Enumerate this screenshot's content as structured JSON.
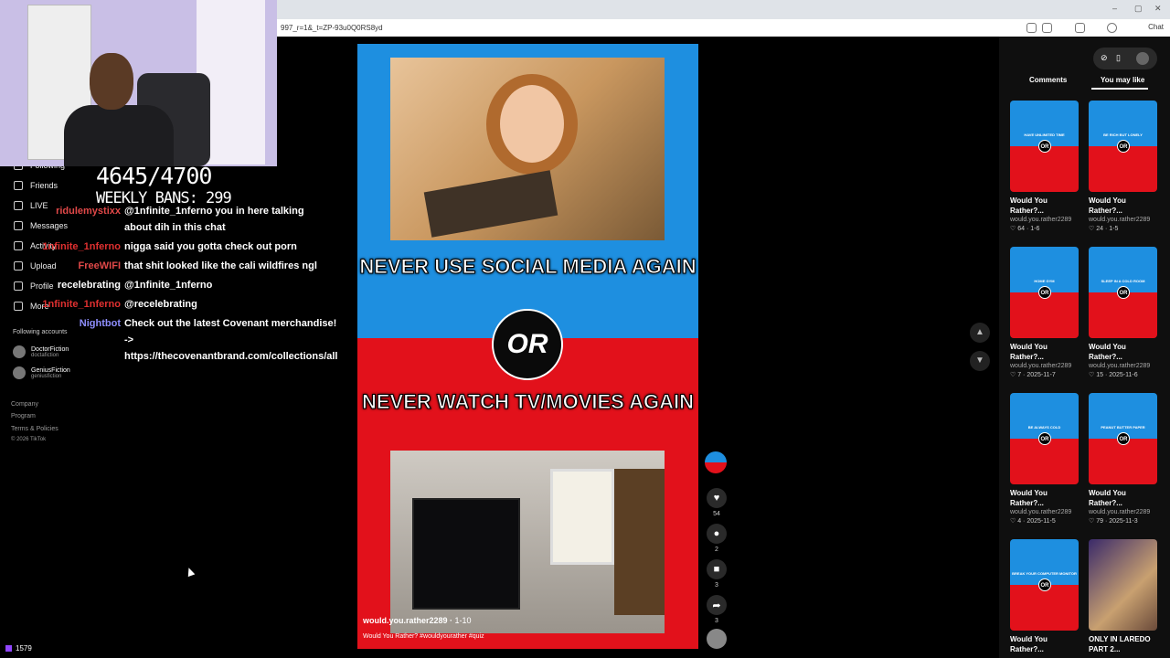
{
  "browser": {
    "url": "997_r=1&_t=ZP-93u0Q0RS8yd",
    "chat_label": "Chat",
    "window_controls": [
      "–",
      "▢",
      "✕"
    ]
  },
  "nav": {
    "items": [
      "Following",
      "Friends",
      "LIVE",
      "Messages",
      "Activity",
      "Upload",
      "Profile",
      "More"
    ],
    "following_accounts_label": "Following accounts",
    "accounts": [
      {
        "name": "DoctorFiction",
        "handle": "doctafiction"
      },
      {
        "name": "GeniusFiction",
        "handle": "geniusfiction"
      }
    ],
    "footer": [
      "Company",
      "Program",
      "Terms & Policies",
      "© 2026 TikTok"
    ]
  },
  "stream": {
    "counter": "4645/4700",
    "weekly_bans": "WEEKLY BANS: 299",
    "viewers": "1579",
    "chat": [
      {
        "user": "ridulemystixx",
        "color": "#e04848",
        "text": "@1nfinite_1nferno you in here talking about dih in this chat"
      },
      {
        "user": "1nfinite_1nferno",
        "color": "#e03030",
        "text": "nigga said you gotta check out porn"
      },
      {
        "user": "FreeWIFI",
        "color": "#e04848",
        "text": "that shit looked like the cali wildfires ngl"
      },
      {
        "user": "recelebrating",
        "color": "#ffffff",
        "text": "@1nfinite_1nferno"
      },
      {
        "user": "1nfinite_1nferno",
        "color": "#e03030",
        "text": "@recelebrating"
      },
      {
        "user": "Nightbot",
        "color": "#8f8fff",
        "text": "Check out the latest Covenant merchandise! -> https://thecovenantbrand.com/collections/all"
      }
    ]
  },
  "video": {
    "option_a": "NEVER USE SOCIAL MEDIA AGAIN",
    "or": "OR",
    "option_b": "NEVER WATCH TV/MOVIES AGAIN",
    "author": "would.you.rather2289",
    "date": "1-10",
    "caption": "Would You Rather? #wouldyourather #quiz",
    "likes": "54",
    "comments": "2",
    "saves": "3",
    "shares": "3"
  },
  "panel": {
    "tabs": [
      "Comments",
      "You may like"
    ],
    "cards": [
      {
        "title": "Would You Rather?...",
        "author": "would.you.rather2289",
        "stats": "♡ 64 · 1-6",
        "tag": "HAVE UNLIMITED TIME"
      },
      {
        "title": "Would You Rather?...",
        "author": "would.you.rather2289",
        "stats": "♡ 24 · 1-5",
        "tag": "BE RICH BUT LONELY"
      },
      {
        "title": "Would You Rather?...",
        "author": "would.you.rather2289",
        "stats": "♡ 7 · 2025-11-7",
        "tag": "HOME GYM"
      },
      {
        "title": "Would You Rather?...",
        "author": "would.you.rather2289",
        "stats": "♡ 15 · 2025-11-6",
        "tag": "SLEEP IN A COLD ROOM"
      },
      {
        "title": "Would You Rather?...",
        "author": "would.you.rather2289",
        "stats": "♡ 4 · 2025-11-5",
        "tag": "BE ALWAYS COLD"
      },
      {
        "title": "Would You Rather?...",
        "author": "would.you.rather2289",
        "stats": "♡ 79 · 2025-11-3",
        "tag": "PEANUT BUTTER PAPER"
      },
      {
        "title": "Would You Rather?...",
        "author": "",
        "stats": "",
        "tag": "BREAK YOUR COMPUTER MONITOR"
      },
      {
        "title": "ONLY IN LAREDO PART 2...",
        "author": "",
        "stats": "",
        "tag": ""
      }
    ]
  }
}
